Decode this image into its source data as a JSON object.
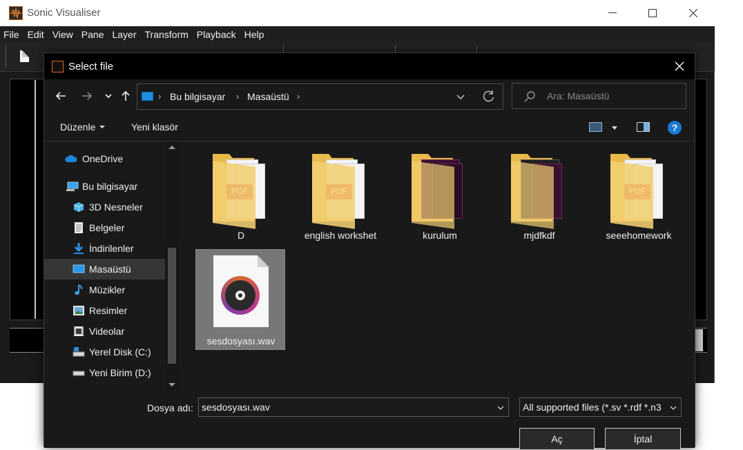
{
  "app": {
    "title": "Sonic Visualiser",
    "menu": [
      "File",
      "Edit",
      "View",
      "Pane",
      "Layer",
      "Transform",
      "Playback",
      "Help"
    ]
  },
  "dialog": {
    "title": "Select file",
    "breadcrumb": [
      "Bu bilgisayar",
      "Masaüstü"
    ],
    "search_placeholder": "Ara: Masaüstü",
    "commands": {
      "organize": "Düzenle",
      "new_folder": "Yeni klasör",
      "help": "?"
    },
    "nav_items": [
      {
        "label": "OneDrive",
        "icon": "cloud-icon"
      },
      {
        "label": "Bu bilgisayar",
        "icon": "computer-icon"
      },
      {
        "label": "3D Nesneler",
        "icon": "cube-icon"
      },
      {
        "label": "Belgeler",
        "icon": "document-icon"
      },
      {
        "label": "İndirilenler",
        "icon": "download-icon"
      },
      {
        "label": "Masaüstü",
        "icon": "desktop-icon",
        "selected": true
      },
      {
        "label": "Müzikler",
        "icon": "music-note-icon"
      },
      {
        "label": "Resimler",
        "icon": "picture-icon"
      },
      {
        "label": "Videolar",
        "icon": "video-icon"
      },
      {
        "label": "Yerel Disk (C:)",
        "icon": "drive-icon"
      },
      {
        "label": "Yeni Birim (D:)",
        "icon": "drive-icon"
      }
    ],
    "files": [
      {
        "name": "D",
        "type": "folder"
      },
      {
        "name": "english workshet",
        "type": "folder"
      },
      {
        "name": "kurulum",
        "type": "folder"
      },
      {
        "name": "mjdfkdf",
        "type": "folder"
      },
      {
        "name": "seeehomework",
        "type": "folder"
      },
      {
        "name": "sesdosyası.wav",
        "type": "wav",
        "selected": true
      }
    ],
    "filename_label": "Dosya adı:",
    "filename_value": "sesdosyası.wav",
    "filetype_value": "All supported files (*.sv *.rdf *.n3",
    "open_button": "Aç",
    "cancel_button": "İptal"
  },
  "colors": {
    "accent": "#1a78d4",
    "folder": "#e9b94a",
    "selection": "#777777"
  }
}
